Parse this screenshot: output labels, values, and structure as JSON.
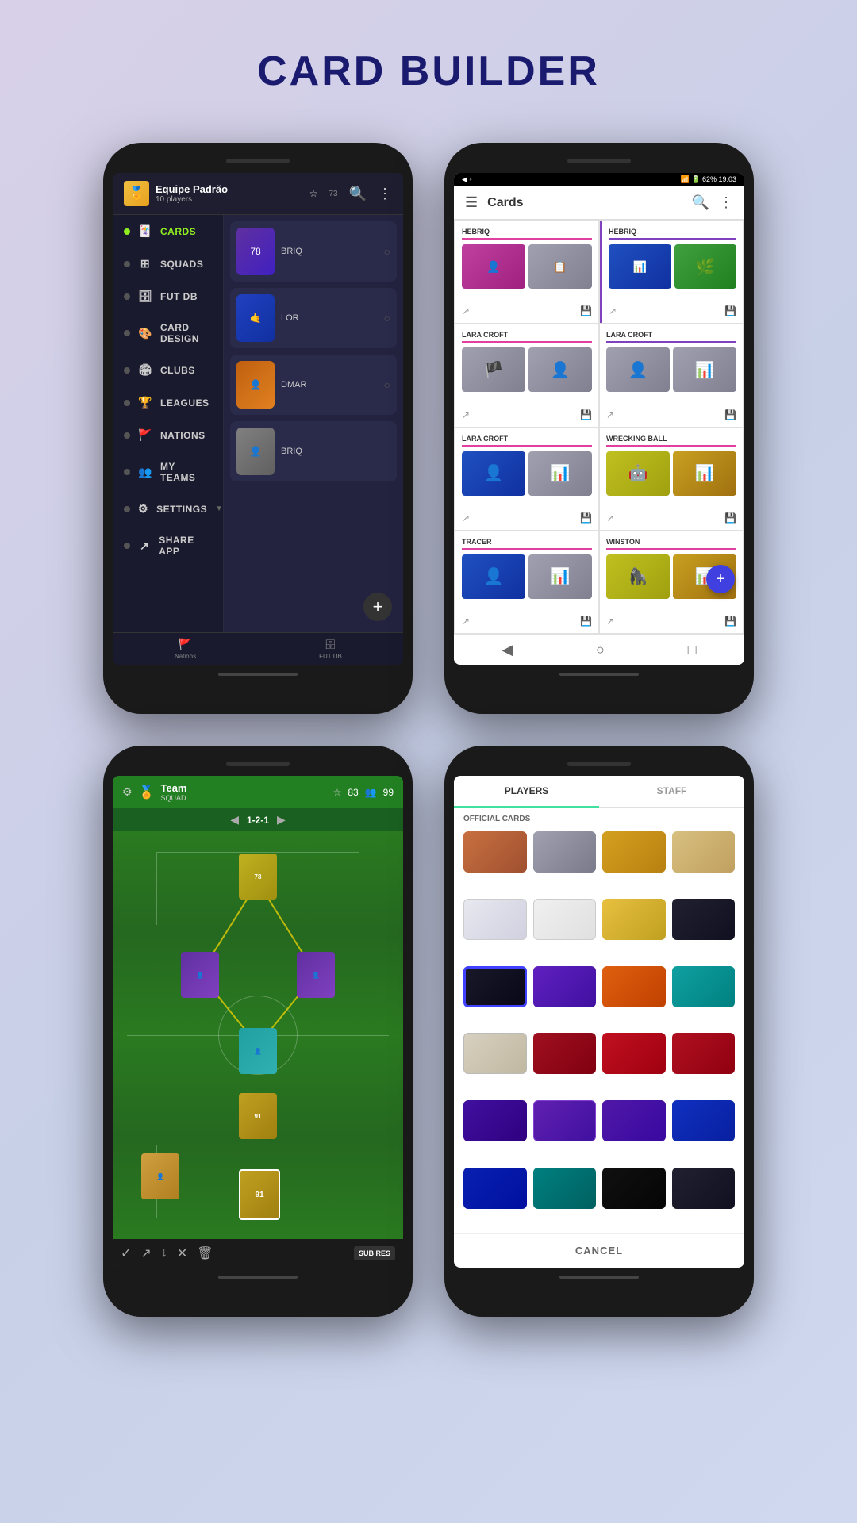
{
  "app": {
    "title": "CARD BUILDER"
  },
  "phone1": {
    "team_name": "Equipe Padrão",
    "players_count": "10 players",
    "rating": "73",
    "menu_items": [
      {
        "label": "CARDS",
        "active": true,
        "icon": "●"
      },
      {
        "label": "SQUADS",
        "active": false,
        "icon": "⊞"
      },
      {
        "label": "FUT DB",
        "active": false,
        "icon": "🗄"
      },
      {
        "label": "CARD DESIGN",
        "active": false,
        "icon": "🎨"
      },
      {
        "label": "CLUBS",
        "active": false,
        "icon": "🏟"
      },
      {
        "label": "LEAGUES",
        "active": false,
        "icon": "🏆"
      },
      {
        "label": "NATIONS",
        "active": false,
        "icon": "🚩"
      },
      {
        "label": "MY TEAMS",
        "active": false,
        "icon": "👥"
      },
      {
        "label": "SETTINGS",
        "active": false,
        "icon": "⚙"
      },
      {
        "label": "SHARE APP",
        "active": false,
        "icon": "↗"
      }
    ],
    "nav_items": [
      {
        "label": "Nations",
        "icon": "🚩"
      },
      {
        "label": "FUT DB",
        "icon": "🗄"
      }
    ]
  },
  "phone2": {
    "status_time": "19:03",
    "status_battery": "62%",
    "title": "Cards",
    "cards": [
      {
        "name": "HEBRIQ",
        "color": "pink"
      },
      {
        "name": "HEBRIQ",
        "color": "purple"
      },
      {
        "name": "LARA CROFT",
        "color": "pink"
      },
      {
        "name": "LARA CROFT",
        "color": "purple"
      },
      {
        "name": "LARA CROFT",
        "color": "pink"
      },
      {
        "name": "WRECKING BALL",
        "color": "pink"
      },
      {
        "name": "TRACER",
        "color": "pink"
      },
      {
        "name": "WINSTON",
        "color": "pink"
      }
    ]
  },
  "phone3": {
    "team_label": "SQUAD",
    "team_name": "Team",
    "star_rating": "83",
    "player_count": "99",
    "formation": "1-2-1",
    "toolbar_items": [
      {
        "icon": "✓"
      },
      {
        "icon": "↗"
      },
      {
        "icon": "↓"
      },
      {
        "icon": "✕"
      },
      {
        "icon": "🗑"
      }
    ],
    "sub_res_label": "SUB RES"
  },
  "phone4": {
    "tabs": [
      {
        "label": "PLAYERS",
        "active": true
      },
      {
        "label": "STAFF",
        "active": false
      }
    ],
    "section_label": "OFFICIAL CARDS",
    "card_types": [
      {
        "style": "ct-bronze"
      },
      {
        "style": "ct-silver"
      },
      {
        "style": "ct-gold"
      },
      {
        "style": "ct-light"
      },
      {
        "style": "ct-white"
      },
      {
        "style": "ct-white2"
      },
      {
        "style": "ct-gold2"
      },
      {
        "style": "ct-black"
      },
      {
        "style": "ct-dark-selected"
      },
      {
        "style": "ct-purple"
      },
      {
        "style": "ct-orange"
      },
      {
        "style": "ct-teal"
      },
      {
        "style": "ct-light-s"
      },
      {
        "style": "ct-red"
      },
      {
        "style": "ct-red2"
      },
      {
        "style": "ct-red3"
      },
      {
        "style": "ct-purple2"
      },
      {
        "style": "ct-purple3"
      },
      {
        "style": "ct-purple4"
      },
      {
        "style": "ct-blue"
      },
      {
        "style": "ct-blue2"
      },
      {
        "style": "ct-blue3"
      },
      {
        "style": "ct-dkblue"
      },
      {
        "style": "ct-blue-gr"
      },
      {
        "style": "ct-teal2"
      },
      {
        "style": "ct-black2"
      },
      {
        "style": "ct-black3"
      },
      {
        "style": "ct-black"
      }
    ],
    "cancel_label": "CANCEL"
  }
}
